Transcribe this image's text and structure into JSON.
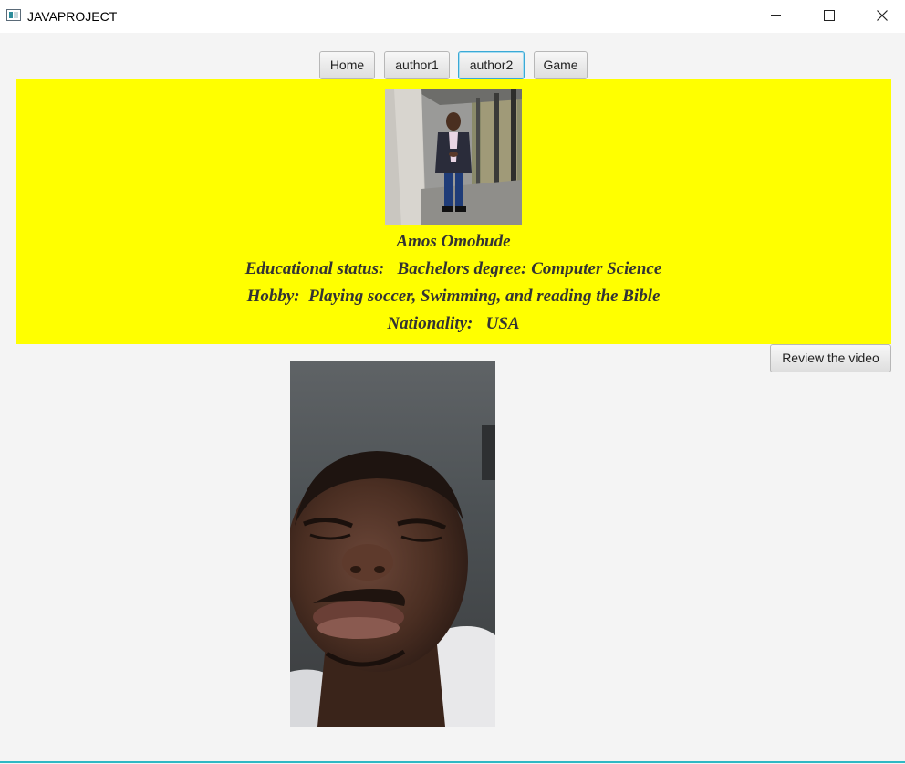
{
  "window": {
    "title": "JAVAPROJECT"
  },
  "nav": {
    "buttons": [
      {
        "label": "Home"
      },
      {
        "label": "author1"
      },
      {
        "label": "author2"
      },
      {
        "label": "Game"
      }
    ],
    "active": "author2"
  },
  "author": {
    "name": "Amos Omobude",
    "education": "Educational status:   Bachelors degree: Computer Science",
    "hobby": "Hobby:  Playing soccer, Swimming, and reading the Bible",
    "nationality": "Nationality:   USA"
  },
  "review_button_label": "Review the video",
  "colors": {
    "panel_background": "#ffff00",
    "panel_text": "#333333",
    "window_background": "#f4f4f4",
    "focus_border": "#3aa9d6"
  }
}
